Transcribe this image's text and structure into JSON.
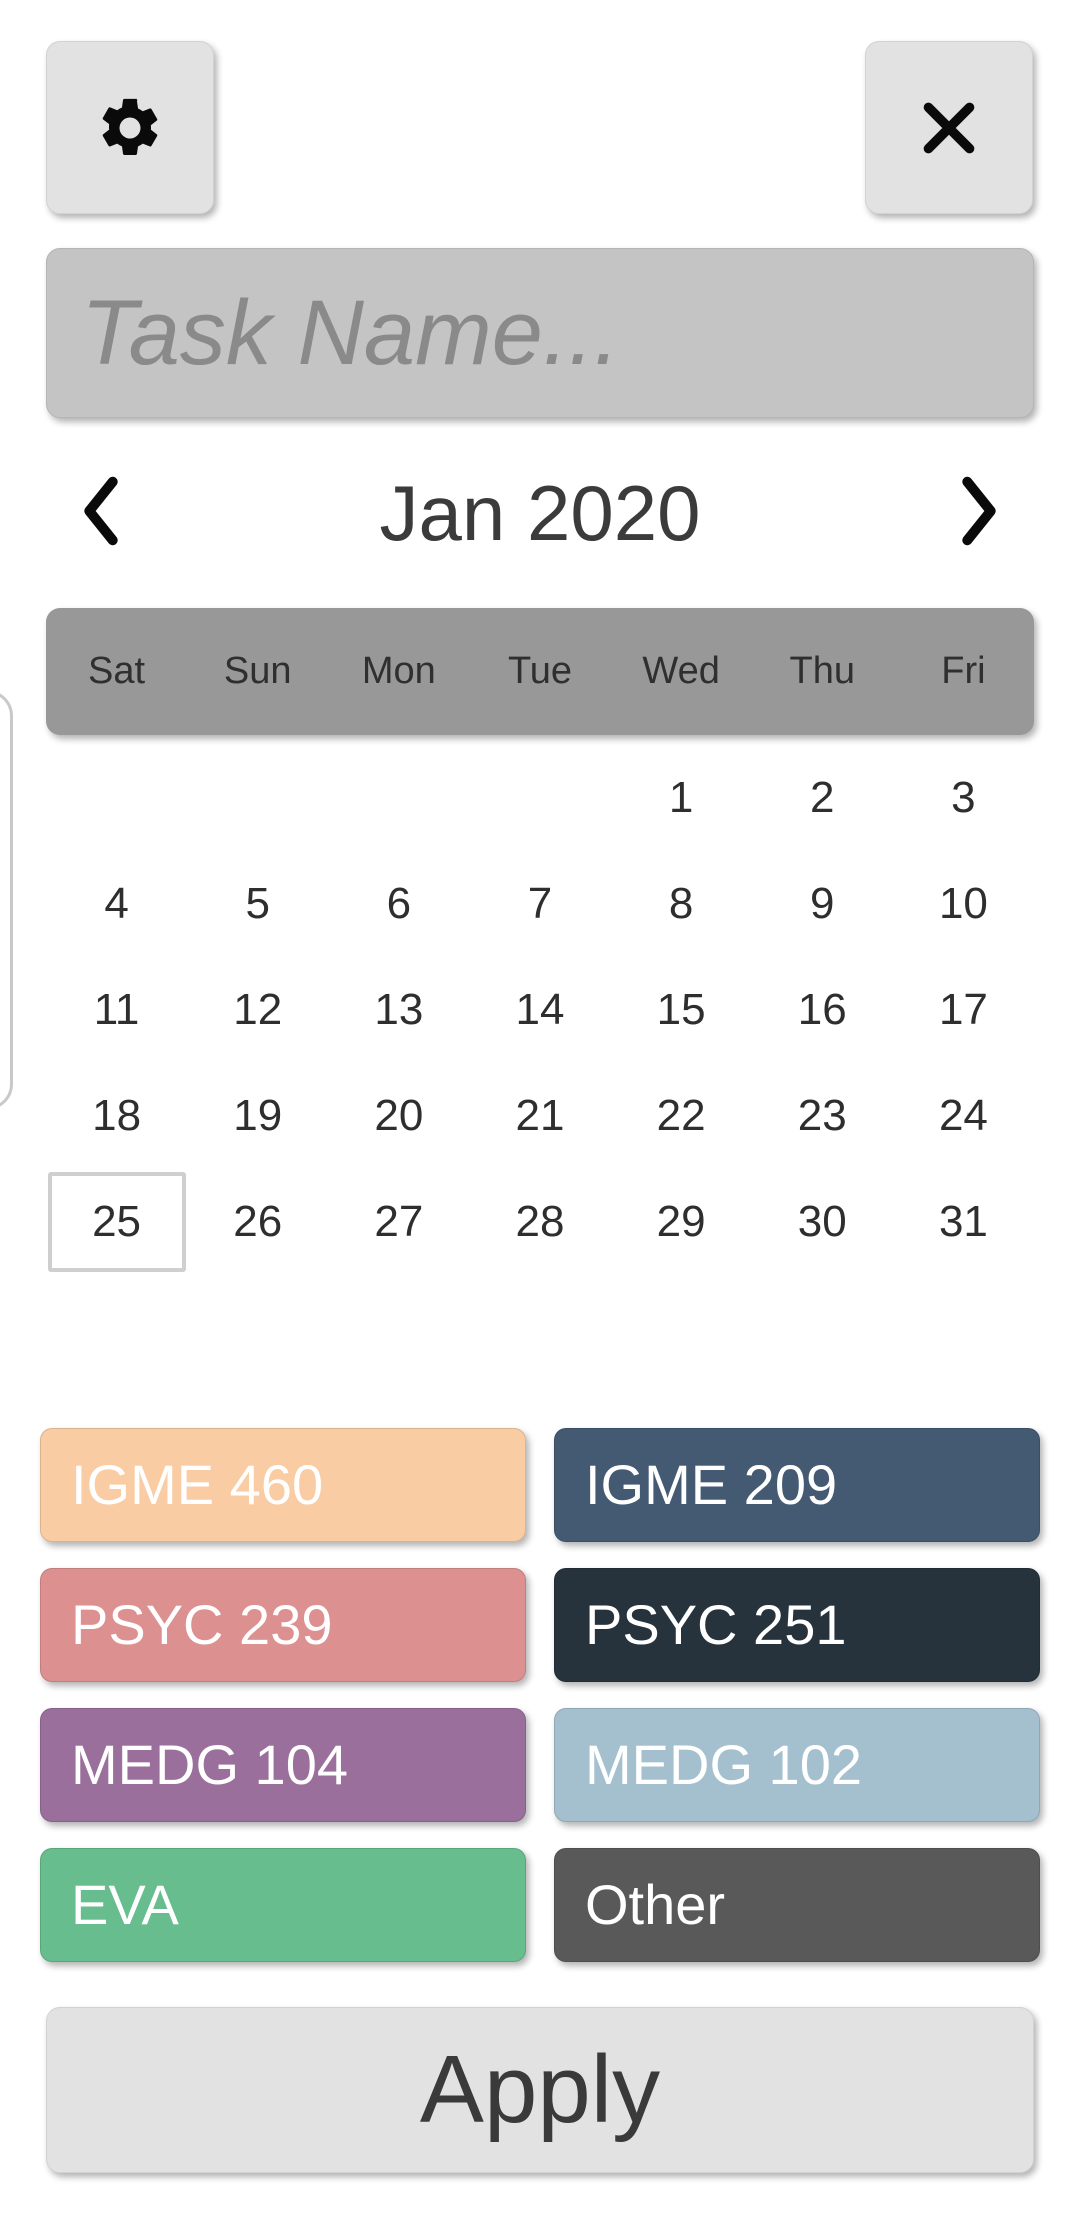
{
  "toolbar": {
    "settings_icon": "gear-icon",
    "close_icon": "close-icon"
  },
  "task_field": {
    "value": "",
    "placeholder": "Task Name..."
  },
  "calendar": {
    "prev_icon": "chevron-left-icon",
    "next_icon": "chevron-right-icon",
    "month_label": "Jan 2020",
    "weekdays": [
      "Sat",
      "Sun",
      "Mon",
      "Tue",
      "Wed",
      "Thu",
      "Fri"
    ],
    "leading_blanks": 4,
    "days": [
      1,
      2,
      3,
      4,
      5,
      6,
      7,
      8,
      9,
      10,
      11,
      12,
      13,
      14,
      15,
      16,
      17,
      18,
      19,
      20,
      21,
      22,
      23,
      24,
      25,
      26,
      27,
      28,
      29,
      30,
      31
    ],
    "selected_day": 25,
    "header_bg": "#989898"
  },
  "courses": [
    {
      "label": "IGME 460",
      "color": "#f9cca3",
      "text_color": "#ffffff"
    },
    {
      "label": "IGME 209",
      "color": "#435a72",
      "text_color": "#ffffff"
    },
    {
      "label": "PSYC 239",
      "color": "#dd9090",
      "text_color": "#ffffff"
    },
    {
      "label": "PSYC 251",
      "color": "#27333c",
      "text_color": "#ffffff"
    },
    {
      "label": "MEDG 104",
      "color": "#9a6f9c",
      "text_color": "#ffffff"
    },
    {
      "label": "MEDG 102",
      "color": "#a4c0cf",
      "text_color": "#ffffff"
    },
    {
      "label": "EVA",
      "color": "#67bd8e",
      "text_color": "#ffffff"
    },
    {
      "label": "Other",
      "color": "#595959",
      "text_color": "#ffffff"
    }
  ],
  "apply": {
    "label": "Apply"
  }
}
